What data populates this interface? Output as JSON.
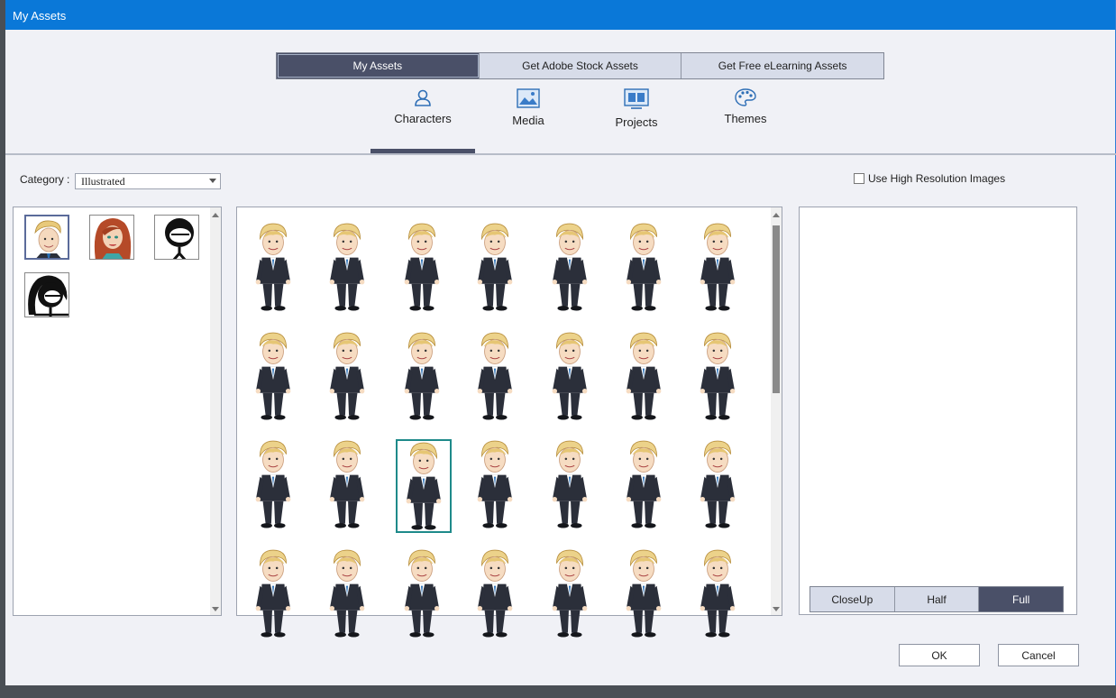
{
  "window": {
    "title": "My Assets"
  },
  "top_tabs": [
    {
      "label": "My Assets",
      "active": true
    },
    {
      "label": "Get Adobe Stock Assets",
      "active": false
    },
    {
      "label": "Get Free eLearning Assets",
      "active": false
    }
  ],
  "category_tabs": [
    {
      "label": "Characters",
      "icon": "person-icon",
      "active": true
    },
    {
      "label": "Media",
      "icon": "image-icon",
      "active": false
    },
    {
      "label": "Projects",
      "icon": "projects-icon",
      "active": false
    },
    {
      "label": "Themes",
      "icon": "palette-icon",
      "active": false
    }
  ],
  "filters": {
    "category_label": "Category :",
    "category_value": "Illustrated",
    "high_res_label": "Use High Resolution Images",
    "high_res_checked": false
  },
  "character_types": [
    "businessman",
    "red-haired woman",
    "stick figure man",
    "stick figure woman"
  ],
  "poses": {
    "rows": 4,
    "columns": 7,
    "selected_index": 16
  },
  "view_buttons": [
    {
      "label": "CloseUp",
      "active": false
    },
    {
      "label": "Half",
      "active": false
    },
    {
      "label": "Full",
      "active": true
    }
  ],
  "footer": {
    "ok_label": "OK",
    "cancel_label": "Cancel"
  },
  "colors": {
    "title_bar": "#0a78d8",
    "active_tab": "#4a5068",
    "selection": "#1e8a8a"
  }
}
